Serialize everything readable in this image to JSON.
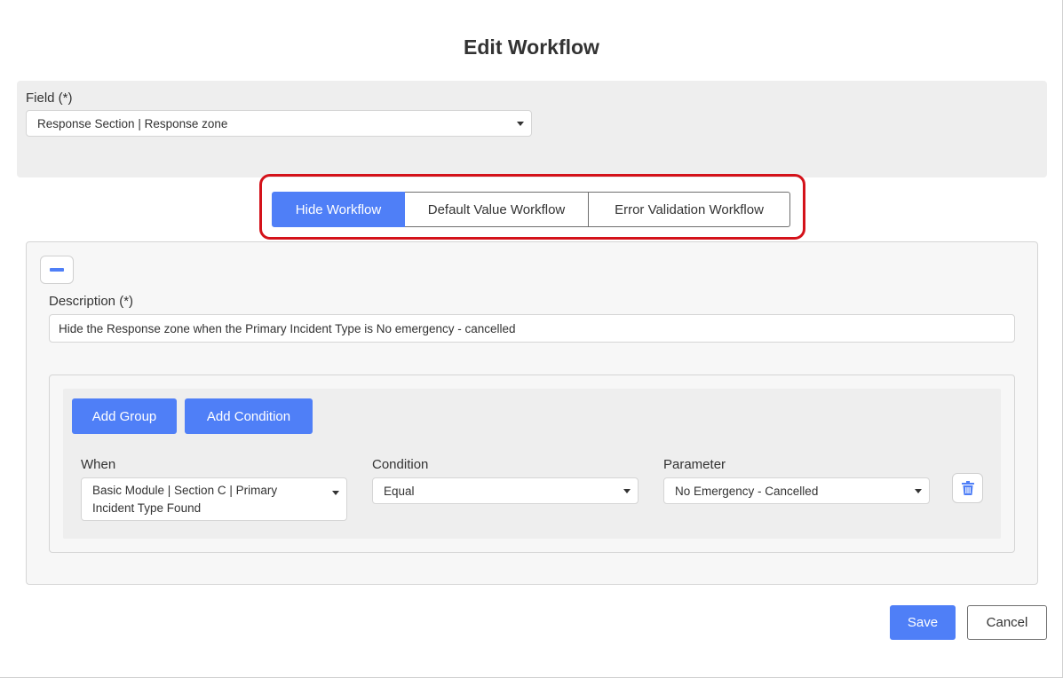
{
  "dialog": {
    "title": "Edit Workflow"
  },
  "field": {
    "label": "Field (*)",
    "selected": "Response Section | Response zone"
  },
  "tabs": [
    {
      "label": "Hide Workflow",
      "active": true
    },
    {
      "label": "Default Value Workflow",
      "active": false
    },
    {
      "label": "Error Validation Workflow",
      "active": false
    }
  ],
  "workflow": {
    "description_label": "Description (*)",
    "description_value": "Hide the Response zone when the Primary Incident Type is No emergency - cancelled",
    "add_group_label": "Add Group",
    "add_condition_label": "Add Condition",
    "condition_row": {
      "when_label": "When",
      "when_value": "Basic Module | Section C | Primary Incident Type Found",
      "condition_label": "Condition",
      "condition_value": "Equal",
      "parameter_label": "Parameter",
      "parameter_value": "No Emergency - Cancelled"
    }
  },
  "footer": {
    "save_label": "Save",
    "cancel_label": "Cancel"
  },
  "colors": {
    "primary": "#4f7ff7",
    "highlight": "#d4121a",
    "panel_bg": "#eeeeee"
  },
  "icons": {
    "collapse": "minus-icon",
    "delete": "trash-icon",
    "dropdown": "caret-down-icon"
  }
}
